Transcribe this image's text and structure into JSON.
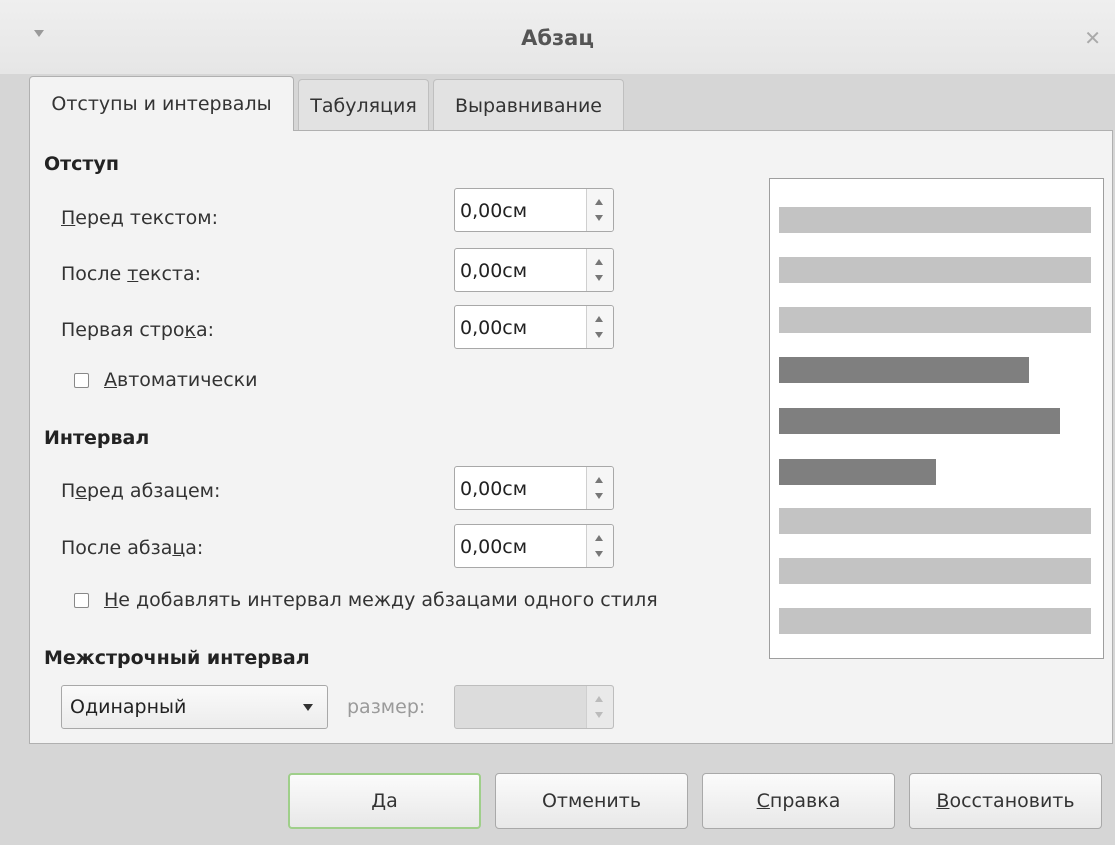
{
  "window": {
    "title": "Абзац"
  },
  "tabs": [
    {
      "label": "Отступы и интервалы",
      "active": true
    },
    {
      "label": "Табуляция",
      "active": false
    },
    {
      "label": "Выравнивание",
      "active": false
    }
  ],
  "indent": {
    "title": "Отступ",
    "before_text": {
      "label_pre": "",
      "label_u": "П",
      "label_post": "еред текстом:",
      "value": "0,00см"
    },
    "after_text": {
      "label_pre": "После ",
      "label_u": "т",
      "label_post": "екста:",
      "value": "0,00см"
    },
    "first_line": {
      "label_pre": "Первая стро",
      "label_u": "к",
      "label_post": "а:",
      "value": "0,00см"
    },
    "automatic": {
      "label_pre": "",
      "label_u": "А",
      "label_post": "втоматически",
      "checked": false
    }
  },
  "spacing": {
    "title": "Интервал",
    "before_paragraph": {
      "label_pre": "П",
      "label_u": "е",
      "label_post": "ред абзацем:",
      "value": "0,00см"
    },
    "after_paragraph": {
      "label_pre": "После абза",
      "label_u": "ц",
      "label_post": "а:",
      "value": "0,00см"
    },
    "no_space_same_style": {
      "label_pre": "",
      "label_u": "Н",
      "label_post": "е добавлять интервал между абзацами одного стиля",
      "checked": false
    }
  },
  "line_spacing": {
    "title": "Межстрочный интервал",
    "selected": "Одинарный",
    "size_label": "размер:",
    "size_value": ""
  },
  "buttons": {
    "ok": "Да",
    "cancel": "Отменить",
    "help_u": "С",
    "help_rest": "правка",
    "reset_u": "В",
    "reset_rest": "осстановить"
  },
  "colors": {
    "preview_light": "#c3c3c3",
    "preview_dark": "#7f7f7f",
    "default_button_border": "#9fcf8a"
  },
  "icons": {
    "window_menu": "chevron-down-icon",
    "close": "close-icon",
    "spin_up": "arrow-up-icon",
    "spin_down": "arrow-down-icon",
    "dropdown": "caret-down-icon"
  }
}
